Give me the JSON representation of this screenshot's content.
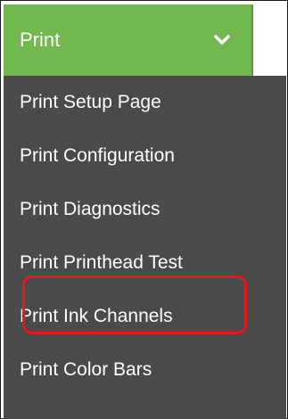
{
  "header": {
    "title": "Print",
    "dropdown_icon": "chevron-down-icon",
    "accent_color": "#72b84e"
  },
  "menu": {
    "items": [
      {
        "label": "Print Setup Page"
      },
      {
        "label": "Print Configuration"
      },
      {
        "label": "Print Diagnostics"
      },
      {
        "label": "Print Printhead Test"
      },
      {
        "label": "Print Ink Channels",
        "highlighted": true
      },
      {
        "label": "Print Color Bars"
      }
    ],
    "background_color": "#4a4a4a",
    "highlight_color": "#e01b1b"
  }
}
